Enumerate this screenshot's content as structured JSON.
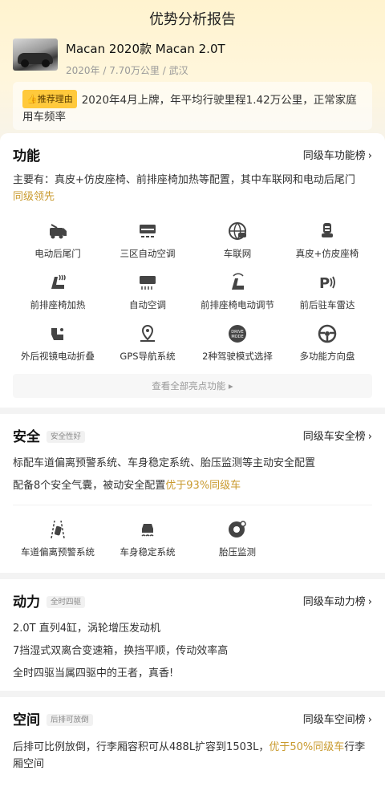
{
  "page_title": "优势分析报告",
  "car": {
    "name": "Macan 2020款 Macan 2.0T",
    "meta": "2020年 / 7.70万公里 / 武汉"
  },
  "reason": {
    "tag": "推荐理由",
    "text": "2020年4月上牌，年平均行驶里程1.42万公里，正常家庭用车频率"
  },
  "features": {
    "title": "功能",
    "link": "同级车功能榜",
    "desc": "主要有：真皮+仿皮座椅、前排座椅加热等配置，其中车联网和电动后尾门",
    "desc_highlight": "同级领先",
    "items": [
      {
        "label": "电动后尾门",
        "icon": "tailgate-icon"
      },
      {
        "label": "三区自动空调",
        "icon": "ac-three-zone-icon"
      },
      {
        "label": "车联网",
        "icon": "connected-car-icon"
      },
      {
        "label": "真皮+仿皮座椅",
        "icon": "leather-seat-icon"
      },
      {
        "label": "前排座椅加热",
        "icon": "seat-heating-icon"
      },
      {
        "label": "自动空调",
        "icon": "auto-ac-icon"
      },
      {
        "label": "前排座椅电动调节",
        "icon": "power-seat-icon"
      },
      {
        "label": "前后驻车雷达",
        "icon": "parking-radar-icon"
      },
      {
        "label": "外后视镜电动折叠",
        "icon": "mirror-fold-icon"
      },
      {
        "label": "GPS导航系统",
        "icon": "gps-icon"
      },
      {
        "label": "2种驾驶模式选择",
        "icon": "drive-mode-icon"
      },
      {
        "label": "多功能方向盘",
        "icon": "steering-wheel-icon"
      }
    ],
    "view_all": "查看全部亮点功能 ▸"
  },
  "safety": {
    "title": "安全",
    "badge": "安全性好",
    "link": "同级车安全榜",
    "line1": "标配车道偏离预警系统、车身稳定系统、胎压监测等主动安全配置",
    "line2_prefix": "配备8个安全气囊，被动安全配置",
    "line2_highlight": "优于93%同级车",
    "items": [
      {
        "label": "车道偏离预警系统",
        "icon": "lane-departure-icon"
      },
      {
        "label": "车身稳定系统",
        "icon": "stability-icon"
      },
      {
        "label": "胎压监测",
        "icon": "tire-pressure-icon"
      }
    ]
  },
  "power": {
    "title": "动力",
    "badge": "全时四驱",
    "link": "同级车动力榜",
    "lines": [
      "2.0T 直列4缸，涡轮增压发动机",
      "7挡湿式双离合变速箱，换挡平顺，传动效率高",
      "全时四驱当属四驱中的王者，真香!"
    ]
  },
  "space": {
    "title": "空间",
    "badge": "后排可放倒",
    "link": "同级车空间榜",
    "desc_prefix": "后排可比例放倒，行李厢容积可从488L扩容到1503L，",
    "desc_highlight": "优于50%同级车",
    "desc_suffix": "行李厢空间"
  },
  "colors": {
    "accent_gold": "#c99a2e",
    "tag_yellow": "#ffc93c"
  }
}
